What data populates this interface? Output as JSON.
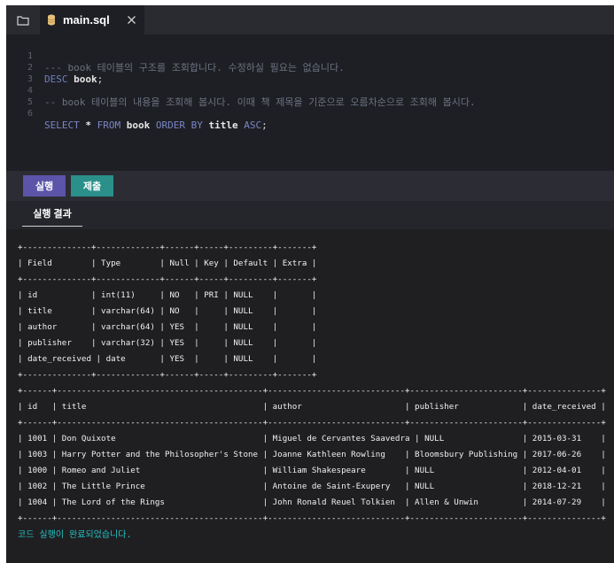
{
  "tabs": [
    {
      "filename": "main.sql",
      "icon": "database-icon"
    }
  ],
  "colors": {
    "run_button": "#5b54a8",
    "submit_button": "#2b8f8a",
    "status_text": "#26c0c0",
    "editor_bg": "#1e1f24"
  },
  "editor": {
    "lines": [
      {
        "num": "1",
        "text": "--- book 테이블의 구조를 조회합니다. 수정하실 필요는 없습니다."
      },
      {
        "num": "2",
        "text": "DESC book;"
      },
      {
        "num": "3",
        "text": ""
      },
      {
        "num": "4",
        "text": "-- book 테이블의 내용을 조회해 봅시다. 이때 책 제목을 기준으로 오름차순으로 조회해 봅시다."
      },
      {
        "num": "5",
        "text": ""
      },
      {
        "num": "6",
        "text": "SELECT * FROM book ORDER BY title ASC;"
      }
    ]
  },
  "toolbar": {
    "run_label": "실행",
    "submit_label": "제출"
  },
  "result_tab_label": "실행 결과",
  "output": {
    "lines": [
      "+--------------+-------------+------+-----+---------+-------+",
      "| Field        | Type        | Null | Key | Default | Extra |",
      "+--------------+-------------+------+-----+---------+-------+",
      "| id           | int(11)     | NO   | PRI | NULL    |       |",
      "| title        | varchar(64) | NO   |     | NULL    |       |",
      "| author       | varchar(64) | YES  |     | NULL    |       |",
      "| publisher    | varchar(32) | YES  |     | NULL    |       |",
      "| date_received | date       | YES  |     | NULL    |       |",
      "+--------------+-------------+------+-----+---------+-------+",
      "+------+------------------------------------------+----------------------------+-----------------------+---------------+",
      "| id   | title                                    | author                     | publisher             | date_received |",
      "+------+------------------------------------------+----------------------------+-----------------------+---------------+",
      "| 1001 | Don Quixote                              | Miguel de Cervantes Saavedra | NULL                | 2015-03-31    |",
      "| 1003 | Harry Potter and the Philosopher's Stone | Joanne Kathleen Rowling    | Bloomsbury Publishing | 2017-06-26    |",
      "| 1000 | Romeo and Juliet                         | William Shakespeare        | NULL                  | 2012-04-01    |",
      "| 1002 | The Little Prince                        | Antoine de Saint-Exupery   | NULL                  | 2018-12-21    |",
      "| 1004 | The Lord of the Rings                    | John Ronald Reuel Tolkien  | Allen & Unwin         | 2014-07-29    |",
      "+------+------------------------------------------+----------------------------+-----------------------+---------------+"
    ],
    "status": "코드 실행이 완료되었습니다."
  }
}
